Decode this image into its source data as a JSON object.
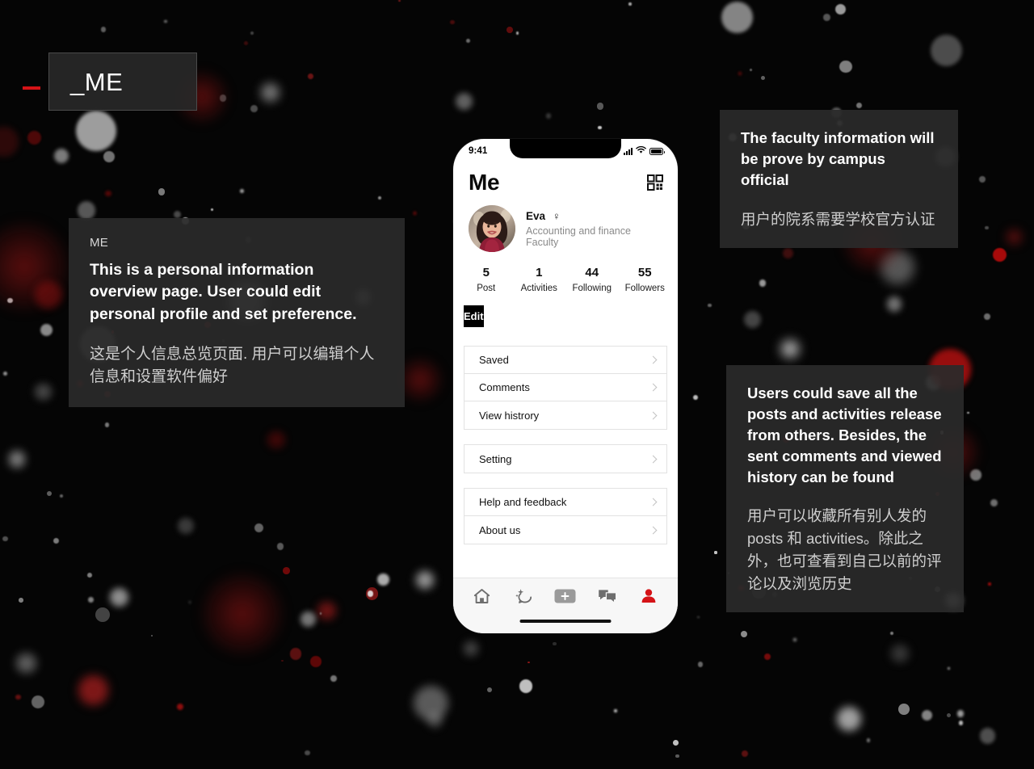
{
  "page": {
    "title_label": "_ME",
    "background_color": "#050505",
    "accent_color": "#d51317",
    "panel_color": "#2a2a2a"
  },
  "notes": {
    "left": {
      "eyebrow": "ME",
      "en": "This is a personal information overview page. User could edit personal profile and set preference.",
      "cn": "这是个人信息总览页面. 用户可以编辑个人信息和设置软件偏好"
    },
    "top_right": {
      "en": "The faculty information will be prove by campus official",
      "cn": "用户的院系需要学校官方认证"
    },
    "bottom_right": {
      "en": "Users could save all the posts and activities release from others. Besides, the sent comments and viewed history can be found",
      "cn": "用户可以收藏所有别人发的 posts 和 activities。除此之外，也可查看到自己以前的评论以及浏览历史"
    }
  },
  "phone": {
    "status_bar": {
      "time": "9:41",
      "signal_icon": "cellular-bars-icon",
      "wifi_icon": "wifi-icon",
      "battery_icon": "battery-icon"
    },
    "header": {
      "title": "Me",
      "qr_icon": "qr-code-icon"
    },
    "profile": {
      "avatar_icon": "user-avatar-photo",
      "name": "Eva",
      "gender_symbol": "♀",
      "faculty": "Accounting and finance Faculty"
    },
    "stats": [
      {
        "num": "5",
        "label": "Post"
      },
      {
        "num": "1",
        "label": "Activities"
      },
      {
        "num": "44",
        "label": "Following"
      },
      {
        "num": "55",
        "label": "Followers"
      }
    ],
    "edit_button": "Edit",
    "menu_groups": [
      {
        "items": [
          {
            "label": "Saved"
          },
          {
            "label": "Comments"
          },
          {
            "label": "View histrory"
          }
        ]
      },
      {
        "items": [
          {
            "label": "Setting"
          }
        ]
      },
      {
        "items": [
          {
            "label": "Help and feedback"
          },
          {
            "label": "About us"
          }
        ]
      }
    ],
    "tabbar": {
      "items": [
        {
          "icon": "home-icon",
          "active": false
        },
        {
          "icon": "activity-sparkle-icon",
          "active": false
        },
        {
          "icon": "add-plus-icon",
          "active": false
        },
        {
          "icon": "chat-bubbles-icon",
          "active": false
        },
        {
          "icon": "profile-person-icon",
          "active": true
        }
      ],
      "active_color": "#d51317",
      "inactive_color": "#6e6e6e"
    }
  }
}
